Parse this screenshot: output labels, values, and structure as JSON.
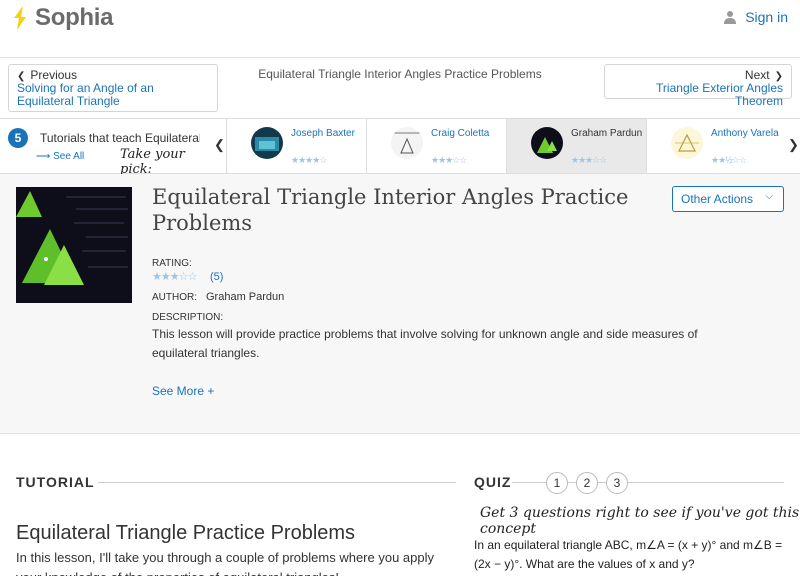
{
  "brand": {
    "name": "Sophia"
  },
  "header": {
    "signin_label": "Sign in"
  },
  "nav": {
    "prev_dir": "Previous",
    "prev_link": "Solving for an Angle of an Equilateral Triangle",
    "next_dir": "Next",
    "next_link": "Triangle Exterior Angles Theorem",
    "page_heading": "Equilateral Triangle Interior Angles Practice Problems"
  },
  "tutorials": {
    "count": "5",
    "label": "Tutorials that teach Equilateral Triangle Interior Angles Practice Problems",
    "see_all": "See All",
    "take_pick": "Take your pick:",
    "authors": [
      {
        "name": "Joseph Baxter",
        "stars": "★★★★☆"
      },
      {
        "name": "Craig Coletta",
        "stars": "★★★☆☆"
      },
      {
        "name": "Graham Pardun",
        "stars": "★★★☆☆"
      },
      {
        "name": "Anthony Varela",
        "stars": "★★½☆☆"
      }
    ]
  },
  "lesson": {
    "title": "Equilateral Triangle Interior Angles Practice Problems",
    "other_actions": "Other Actions",
    "rating_label": "RATING:",
    "rating_stars": "★★★☆☆",
    "rating_count": "(5)",
    "author_label": "AUTHOR:",
    "author": "Graham Pardun",
    "description_label": "DESCRIPTION:",
    "description": "This lesson will provide practice problems that involve solving for unknown angle and side measures of equilateral triangles.",
    "see_more": "See More +"
  },
  "tutorial_section": {
    "heading": "TUTORIAL",
    "title": "Equilateral Triangle Practice Problems",
    "body": "In this lesson, I'll take you through a couple of problems where you apply your knowledge of the properties of equilateral triangles!"
  },
  "quiz": {
    "heading": "QUIZ",
    "numbers": [
      "1",
      "2",
      "3"
    ],
    "hint": "Get 3 questions right to see if you've got this concept",
    "question": "In an equilateral triangle ABC, m∠A = (x + y)° and m∠B = (2x − y)°. What are the values of x and y?"
  },
  "colors": {
    "link": "#1a73b8",
    "brand_yellow": "#f5d20f"
  }
}
